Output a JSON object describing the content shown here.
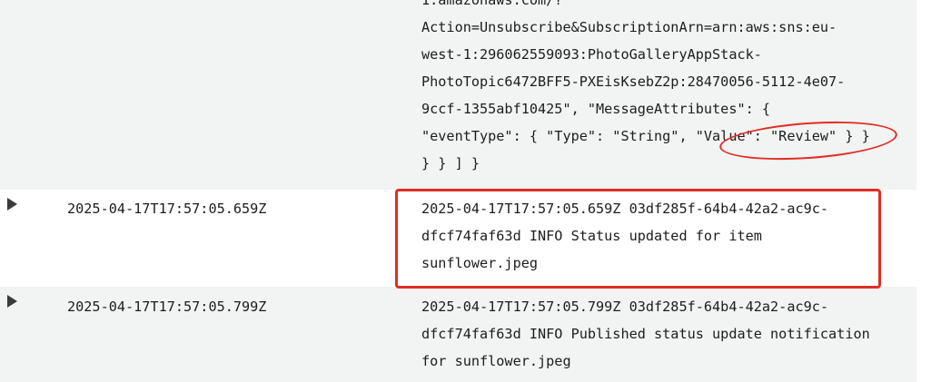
{
  "log_events": [
    {
      "timestamp": "",
      "message_lines": [
        "1.amazonaws.com/?",
        "Action=Unsubscribe&SubscriptionArn=arn:aws:sns:eu-",
        "west-1:296062559093:PhotoGalleryAppStack-",
        "PhotoTopic6472BFF5-PXEisKsebZ2p:28470056-5112-4e07-",
        "9ccf-1355abf10425\", \"MessageAttributes\": {",
        "\"eventType\": { \"Type\": \"String\", \"Value\": \"Review\" } }",
        "} } ] }"
      ]
    },
    {
      "timestamp": "2025-04-17T17:57:05.659Z",
      "message_lines": [
        "2025-04-17T17:57:05.659Z 03df285f-64b4-42a2-ac9c-",
        "dfcf74faf63d INFO Status updated for item",
        "sunflower.jpeg"
      ]
    },
    {
      "timestamp": "2025-04-17T17:57:05.799Z",
      "message_lines": [
        "2025-04-17T17:57:05.799Z 03df285f-64b4-42a2-ac9c-",
        "dfcf74faf63d INFO Published status update notification",
        "for sunflower.jpeg"
      ]
    }
  ],
  "icons": {
    "expand": "caret-right-icon"
  },
  "colors": {
    "row_alt_background": "#f2f3f3",
    "annotation": "#e02e24",
    "text": "#1d1d1d"
  }
}
